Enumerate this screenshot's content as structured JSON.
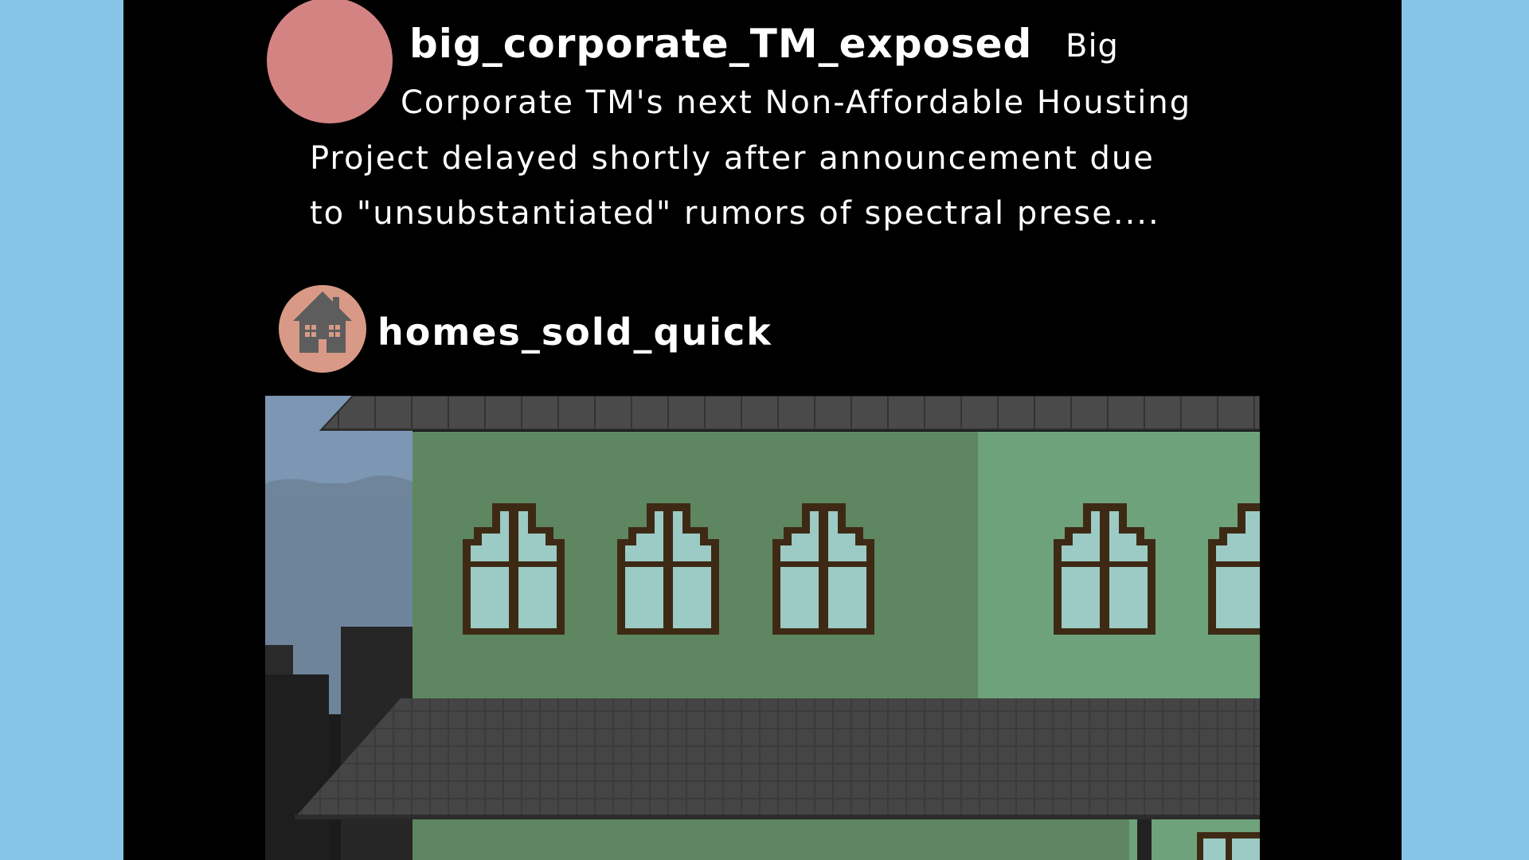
{
  "posts": [
    {
      "username": "big_corporate_TM_exposed",
      "caption_lines": [
        "Big",
        "Corporate TM's next Non-Affordable Housting",
        "Project delayed shortly after announcement due",
        "to \"unsubstantiated\" rumors of spectral prese...."
      ],
      "avatar_color": "#d48383"
    },
    {
      "username": "homes_sold_quick",
      "avatar_icon": "house-icon",
      "avatar_color": "#d89a86"
    }
  ],
  "colors": {
    "background": "#86c5e8",
    "feed_background": "#000000",
    "text": "#ffffff"
  }
}
